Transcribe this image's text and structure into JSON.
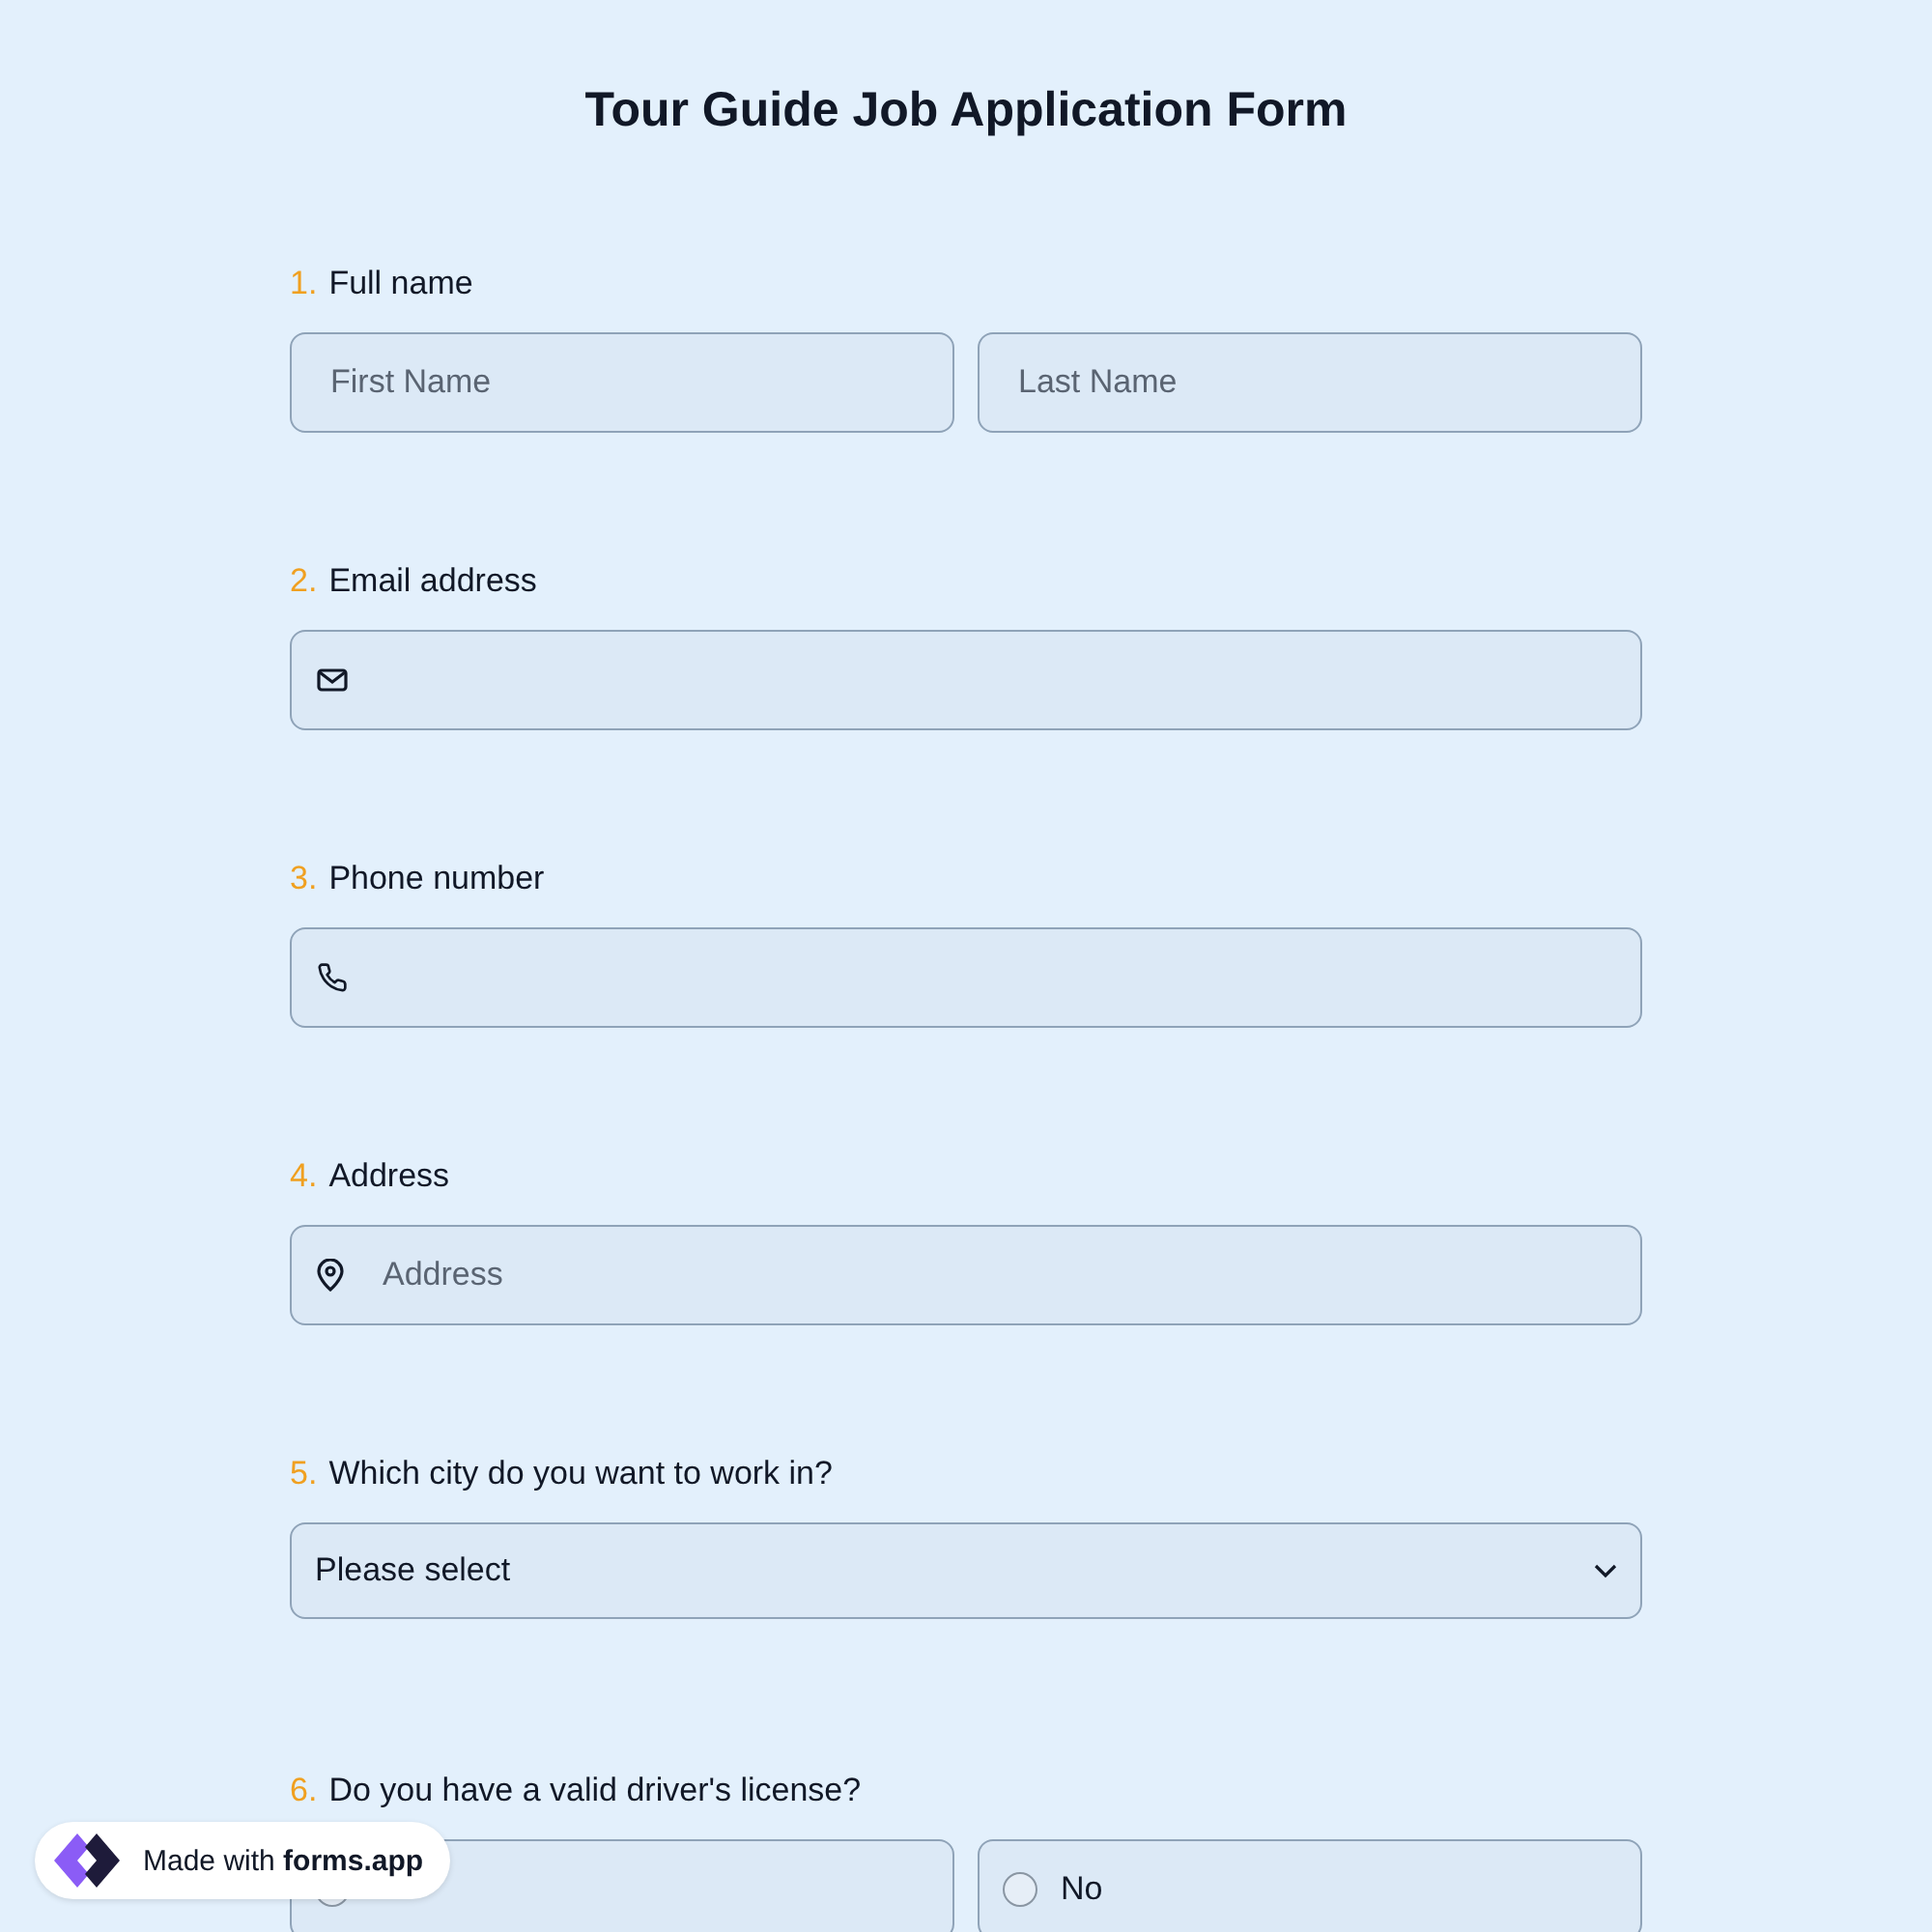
{
  "title": "Tour Guide Job Application Form",
  "questions": [
    {
      "number": "1.",
      "label": "Full name",
      "kind": "name",
      "fields": [
        {
          "placeholder": "First Name"
        },
        {
          "placeholder": "Last Name"
        }
      ]
    },
    {
      "number": "2.",
      "label": "Email address",
      "kind": "email"
    },
    {
      "number": "3.",
      "label": "Phone number",
      "kind": "phone"
    },
    {
      "number": "4.",
      "label": "Address",
      "kind": "address",
      "placeholder": "Address"
    },
    {
      "number": "5.",
      "label": "Which city do you want to work in?",
      "kind": "select",
      "value": "Please select"
    },
    {
      "number": "6.",
      "label": "Do you have a valid driver's license?",
      "kind": "radio",
      "options": [
        {
          "kind": "radio",
          "selected": false
        },
        {
          "kind": "radio",
          "label": "No",
          "selected": false
        }
      ]
    }
  ],
  "badge": {
    "text": "Made with **forms.app**"
  }
}
